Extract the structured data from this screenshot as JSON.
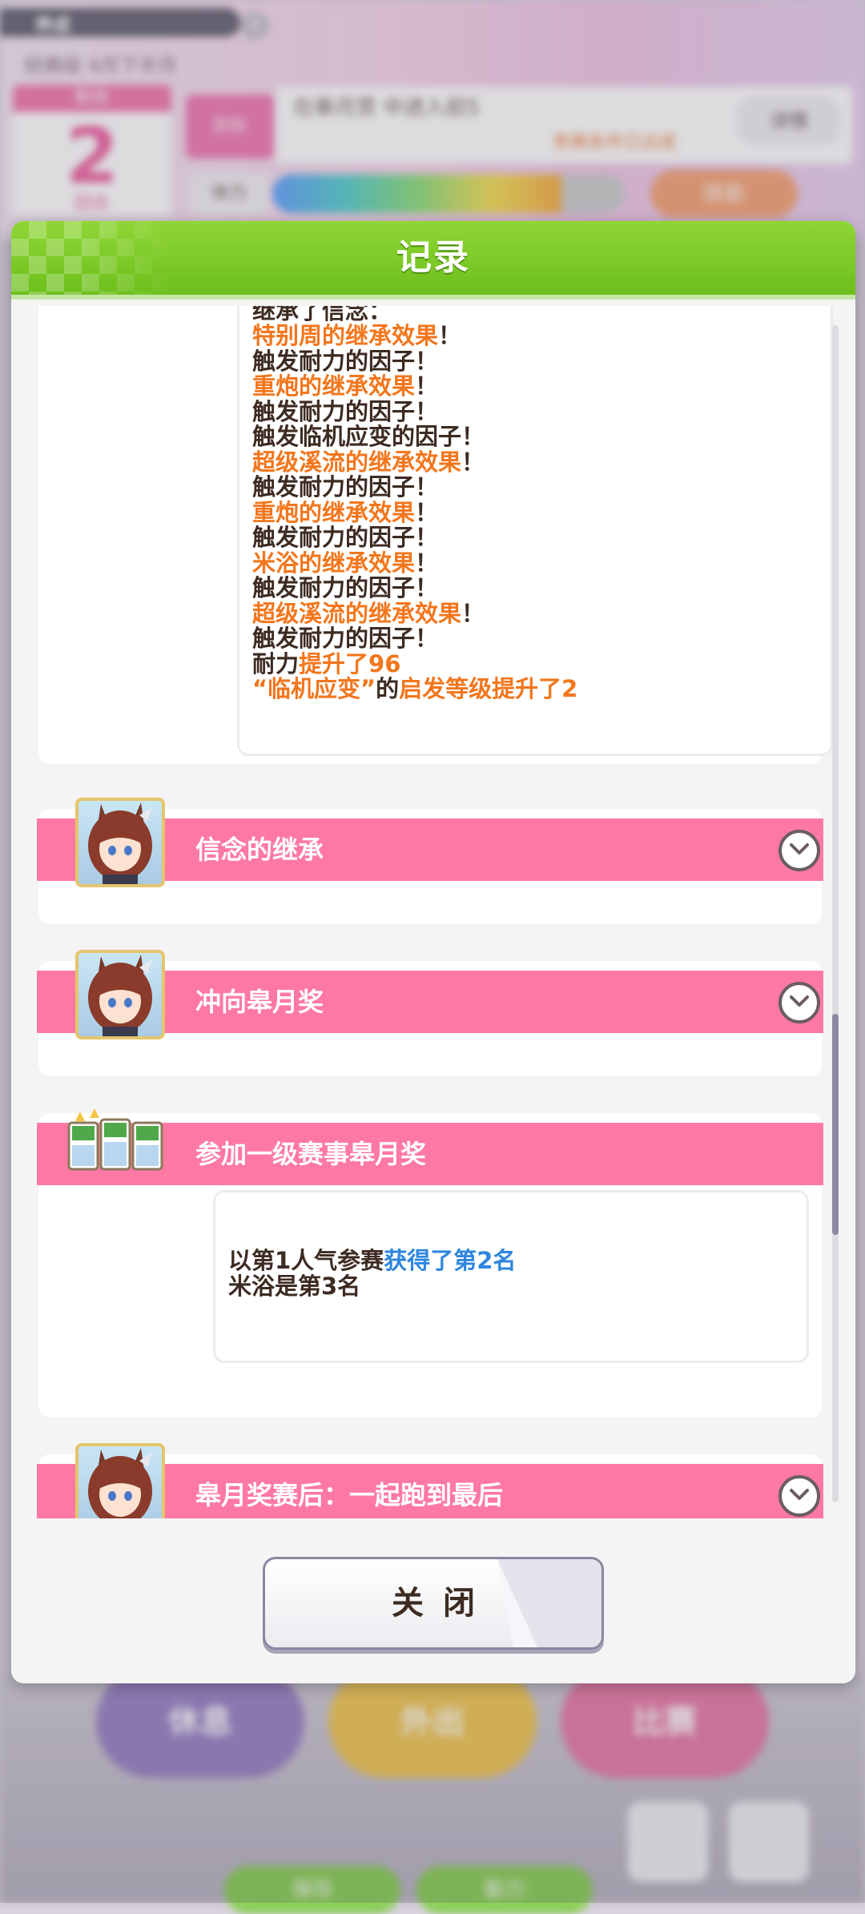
{
  "background": {
    "top_bar_text": "养成",
    "info_icon": "i",
    "subtitle": "经典级 4月下半月",
    "turn_label": "剩余",
    "turn_number": "2",
    "turn_unit": "回合",
    "goal_tag": "目标",
    "goal_text": "在皋月赏 中进入前5",
    "goal_sub": "参赛条件已达成",
    "goal_button": "详情",
    "energy_label": "体力",
    "energy_level": 0.82,
    "skill_button": "技能",
    "bottom_buttons": [
      "休息",
      "外出",
      "比赛"
    ],
    "bottom_pills": [
      "保存",
      "能力"
    ]
  },
  "modal": {
    "title": "记录",
    "scroll_position": 0.72,
    "close_label": "关闭"
  },
  "log": {
    "cut_line": "继承了信念：",
    "entries": [
      {
        "parts": [
          {
            "text": "特别周的继承效果",
            "color": "orange"
          },
          {
            "text": "！",
            "color": "dark"
          }
        ]
      },
      {
        "parts": [
          {
            "text": "触发耐力的因子！",
            "color": "dark"
          }
        ]
      },
      {
        "parts": [
          {
            "text": "重炮的继承效果",
            "color": "orange"
          },
          {
            "text": "！",
            "color": "dark"
          }
        ]
      },
      {
        "parts": [
          {
            "text": "触发耐力的因子！",
            "color": "dark"
          }
        ]
      },
      {
        "parts": [
          {
            "text": "触发临机应变的因子！",
            "color": "dark"
          }
        ]
      },
      {
        "parts": [
          {
            "text": "超级溪流的继承效果",
            "color": "orange"
          },
          {
            "text": "！",
            "color": "dark"
          }
        ]
      },
      {
        "parts": [
          {
            "text": "触发耐力的因子！",
            "color": "dark"
          }
        ]
      },
      {
        "parts": [
          {
            "text": "重炮的继承效果",
            "color": "orange"
          },
          {
            "text": "！",
            "color": "dark"
          }
        ]
      },
      {
        "parts": [
          {
            "text": "触发耐力的因子！",
            "color": "dark"
          }
        ]
      },
      {
        "parts": [
          {
            "text": "米浴的继承效果",
            "color": "orange"
          },
          {
            "text": "！",
            "color": "dark"
          }
        ]
      },
      {
        "parts": [
          {
            "text": "触发耐力的因子！",
            "color": "dark"
          }
        ]
      },
      {
        "parts": [
          {
            "text": "超级溪流的继承效果",
            "color": "orange"
          },
          {
            "text": "！",
            "color": "dark"
          }
        ]
      },
      {
        "parts": [
          {
            "text": "触发耐力的因子！",
            "color": "dark"
          }
        ]
      },
      {
        "parts": [
          {
            "text": "耐力",
            "color": "dark"
          },
          {
            "text": "提升了96",
            "color": "orange"
          }
        ]
      },
      {
        "parts": [
          {
            "text": "“临机应变”",
            "color": "orange"
          },
          {
            "text": "的",
            "color": "dark"
          },
          {
            "text": "启发等级提升了2",
            "color": "orange"
          }
        ]
      }
    ]
  },
  "events": {
    "inherit_title": "信念的继承",
    "satsuki_title": "冲向皋月奖",
    "race_title": "参加一级赛事皋月奖",
    "race_result": [
      {
        "parts": [
          {
            "text": "以第1人气参赛",
            "color": "dark"
          },
          {
            "text": "获得了第2名",
            "color": "blue"
          }
        ]
      },
      {
        "parts": [
          {
            "text": "米浴是第3名",
            "color": "dark"
          }
        ]
      }
    ],
    "after_title": "皋月奖赛后：一起跑到最后"
  },
  "colors": {
    "header_green": "#7bc929",
    "event_pink": "#fd79a4",
    "text_dark": "#3d2b22",
    "text_orange": "#f3761c",
    "text_blue": "#2e86de"
  }
}
